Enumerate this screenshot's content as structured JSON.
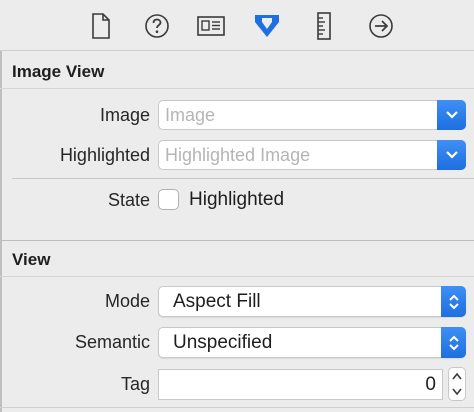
{
  "toolbar": {
    "icons": [
      "file-icon",
      "help-icon",
      "identity-icon",
      "attributes-icon",
      "size-ruler-icon",
      "connections-icon"
    ],
    "active": "attributes-icon",
    "accent": "#1e6fe0"
  },
  "image_view": {
    "title": "Image View",
    "image_label": "Image",
    "image_placeholder": "Image",
    "highlighted_label": "Highlighted",
    "highlighted_placeholder": "Highlighted Image",
    "state_label": "State",
    "state_checkbox_label": "Highlighted",
    "state_checked": false
  },
  "view": {
    "title": "View",
    "mode_label": "Mode",
    "mode_value": "Aspect Fill",
    "semantic_label": "Semantic",
    "semantic_value": "Unspecified",
    "tag_label": "Tag",
    "tag_value": "0"
  }
}
